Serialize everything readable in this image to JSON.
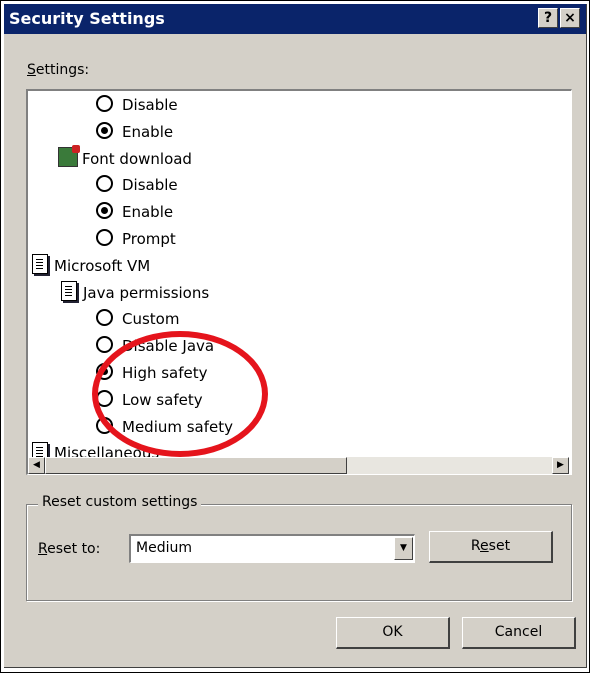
{
  "dialog": {
    "title": "Security Settings",
    "help_button": "?",
    "close_button": "×"
  },
  "settings_label": "Settings:",
  "settings_tree": [
    {
      "kind": "radio",
      "label": "Disable",
      "checked": false
    },
    {
      "kind": "radio",
      "label": "Enable",
      "checked": true
    },
    {
      "kind": "category",
      "icon": "font-download-icon",
      "label": "Font download"
    },
    {
      "kind": "radio",
      "label": "Disable",
      "checked": false
    },
    {
      "kind": "radio",
      "label": "Enable",
      "checked": true
    },
    {
      "kind": "radio",
      "label": "Prompt",
      "checked": false
    },
    {
      "kind": "category",
      "icon": "document-icon",
      "label": "Microsoft VM"
    },
    {
      "kind": "category",
      "icon": "document-icon",
      "label": "Java permissions"
    },
    {
      "kind": "radio",
      "label": "Custom",
      "checked": false
    },
    {
      "kind": "radio",
      "label": "Disable Java",
      "checked": false
    },
    {
      "kind": "radio",
      "label": "High safety",
      "checked": true
    },
    {
      "kind": "radio",
      "label": "Low safety",
      "checked": false
    },
    {
      "kind": "radio",
      "label": "Medium safety",
      "checked": false
    },
    {
      "kind": "category",
      "icon": "document-icon",
      "label": "Miscellaneous"
    }
  ],
  "reset_group": {
    "title": "Reset custom settings",
    "reset_to_label": "Reset to:",
    "reset_to_value": "Medium",
    "reset_button": "Reset"
  },
  "footer": {
    "ok_button": "OK",
    "cancel_button": "Cancel"
  },
  "annotation_color": "#e5141c",
  "titlebar_color": "#0a246a"
}
